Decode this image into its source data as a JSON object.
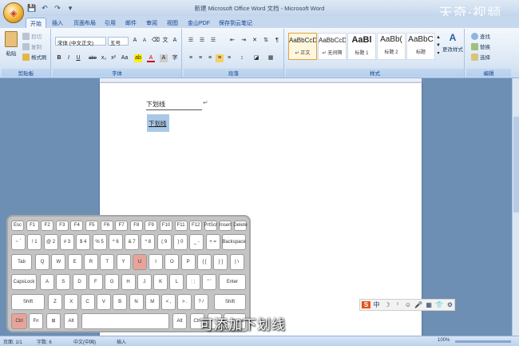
{
  "window": {
    "title": "新建 Microsoft Office Word 文档 - Microsoft Word",
    "watermark": "天奇·视频"
  },
  "tabs": [
    "开始",
    "插入",
    "页面布局",
    "引用",
    "邮件",
    "审阅",
    "视图",
    "金山PDF",
    "保存到云笔记"
  ],
  "clipboard": {
    "paste": "粘贴",
    "cut": "剪切",
    "copy": "复制",
    "format_painter": "格式刷",
    "label": "剪贴板"
  },
  "font": {
    "name": "宋体 (中文正文)",
    "size": "五号",
    "label": "字体",
    "buttons": [
      "B",
      "I",
      "U",
      "abe",
      "x₂",
      "x²",
      "Aa"
    ]
  },
  "paragraph": {
    "label": "段落"
  },
  "styles": {
    "label": "样式",
    "items": [
      {
        "preview": "AaBbCcDd",
        "name": "↵ 正文"
      },
      {
        "preview": "AaBbCcDd",
        "name": "↵ 无间隔"
      },
      {
        "preview": "AaBl",
        "name": "标题 1"
      },
      {
        "preview": "AaBb(",
        "name": "标题 2"
      },
      {
        "preview": "AaBbC",
        "name": "标题"
      }
    ],
    "change": "更改样式"
  },
  "editing": {
    "find": "查找",
    "replace": "替换",
    "select": "选择",
    "label": "编辑"
  },
  "document": {
    "line1": "下划线",
    "line2": "下划线",
    "para_mark": "↵"
  },
  "keyboard": {
    "row1": [
      "Esc",
      "F1",
      "F2",
      "F3",
      "F4",
      "F5",
      "F6",
      "F7",
      "F8",
      "F9",
      "F10",
      "F11",
      "F12",
      "PrtScr",
      "Insert",
      "Delete"
    ],
    "row2": [
      "~ `",
      "! 1",
      "@ 2",
      "# 3",
      "$ 4",
      "% 5",
      "^ 6",
      "& 7",
      "* 8",
      "( 9",
      ") 0",
      "_ -",
      "+ =",
      "Backspace"
    ],
    "row3": [
      "Tab",
      "Q",
      "W",
      "E",
      "R",
      "T",
      "Y",
      "U",
      "I",
      "O",
      "P",
      "{ [",
      "} ]",
      "| \\"
    ],
    "row4": [
      "CapsLock",
      "A",
      "S",
      "D",
      "F",
      "G",
      "H",
      "J",
      "K",
      "L",
      ": ;",
      "\" '",
      "Enter"
    ],
    "row5": [
      "Shift",
      "Z",
      "X",
      "C",
      "V",
      "B",
      "N",
      "M",
      "< ,",
      "> .",
      "? /",
      "Shift"
    ],
    "row6": [
      "Ctrl",
      "Fn",
      "⊞",
      "Alt",
      "",
      "Alt",
      "Ctrl",
      "↑",
      "← Home"
    ],
    "highlighted": [
      "U",
      "Ctrl"
    ]
  },
  "ime": {
    "logo": "S",
    "items": [
      "中",
      "☽",
      "⁾",
      "☺",
      "🎤",
      "▦",
      "👕",
      "⚙"
    ]
  },
  "caption": "可添加下划线",
  "status": {
    "page": "页面: 1/1",
    "words": "字数: 6",
    "lang": "中文(中国)",
    "mode": "插入",
    "zoom": "100%"
  }
}
